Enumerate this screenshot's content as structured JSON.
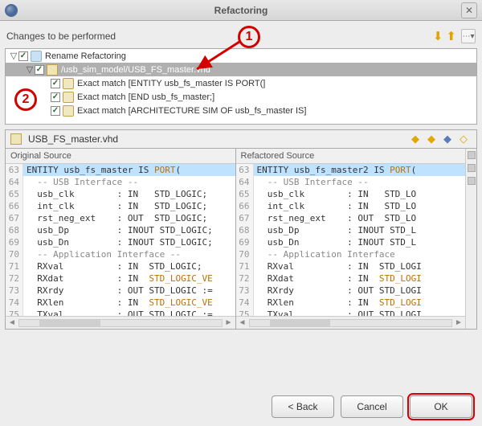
{
  "window": {
    "title": "Refactoring"
  },
  "changes": {
    "header": "Changes to be performed",
    "tree": [
      {
        "indent": 0,
        "expanded": true,
        "icon": "ref",
        "label": "Rename Refactoring"
      },
      {
        "indent": 1,
        "expanded": true,
        "icon": "file",
        "selected": true,
        "label": "/usb_sim_model/USB_FS_master.vhd"
      },
      {
        "indent": 2,
        "icon": "match",
        "label": "Exact match [ENTITY usb_fs_master IS PORT(]"
      },
      {
        "indent": 2,
        "icon": "match",
        "label": "Exact match [END usb_fs_master;]"
      },
      {
        "indent": 2,
        "icon": "match",
        "label": "Exact match [ARCHITECTURE SIM OF usb_fs_master IS]"
      }
    ]
  },
  "file": {
    "name": "USB_FS_master.vhd"
  },
  "diff": {
    "original_title": "Original Source",
    "refactored_title": "Refactored Source",
    "original": [
      {
        "n": 63,
        "hl": true,
        "segs": [
          [
            "ENTITY usb_fs_master IS ",
            ""
          ],
          [
            "PORT",
            "port"
          ],
          [
            "(",
            ""
          ]
        ]
      },
      {
        "n": 64,
        "segs": [
          [
            "  -- USB Interface --",
            "comment"
          ]
        ]
      },
      {
        "n": 65,
        "segs": [
          [
            "  usb_clk        : IN   STD_LOGIC;",
            ""
          ]
        ]
      },
      {
        "n": 66,
        "segs": [
          [
            "  int_clk        : IN   STD_LOGIC;",
            ""
          ]
        ]
      },
      {
        "n": 67,
        "segs": [
          [
            "  rst_neg_ext    : OUT  STD_LOGIC;",
            ""
          ]
        ]
      },
      {
        "n": 68,
        "segs": [
          [
            "  usb_Dp         : INOUT STD_LOGIC;",
            ""
          ]
        ]
      },
      {
        "n": 69,
        "segs": [
          [
            "  usb_Dn         : INOUT STD_LOGIC;",
            ""
          ]
        ]
      },
      {
        "n": 70,
        "segs": [
          [
            "  -- Application Interface --",
            "comment"
          ]
        ]
      },
      {
        "n": 71,
        "segs": [
          [
            "  RXval          : IN  STD_LOGIC;",
            ""
          ]
        ]
      },
      {
        "n": 72,
        "segs": [
          [
            "  RXdat          : IN  ",
            ""
          ],
          [
            "STD_LOGIC_VE",
            "type"
          ]
        ]
      },
      {
        "n": 73,
        "segs": [
          [
            "  RXrdy          : OUT STD_LOGIC :=",
            ""
          ]
        ]
      },
      {
        "n": 74,
        "segs": [
          [
            "  RXlen          : IN  ",
            ""
          ],
          [
            "STD_LOGIC_VE",
            "type"
          ]
        ]
      },
      {
        "n": 75,
        "segs": [
          [
            "  TXval          : OUT STD_LOGIC :=",
            ""
          ]
        ]
      }
    ],
    "refactored": [
      {
        "n": 63,
        "hl": true,
        "segs": [
          [
            "ENTITY usb_fs_master2 IS ",
            ""
          ],
          [
            "PORT",
            "port"
          ],
          [
            "(",
            ""
          ]
        ]
      },
      {
        "n": 64,
        "segs": [
          [
            "  -- USB Interface --",
            "comment"
          ]
        ]
      },
      {
        "n": 65,
        "segs": [
          [
            "  usb_clk        : IN   STD_LO",
            ""
          ]
        ]
      },
      {
        "n": 66,
        "segs": [
          [
            "  int_clk        : IN   STD_LO",
            ""
          ]
        ]
      },
      {
        "n": 67,
        "segs": [
          [
            "  rst_neg_ext    : OUT  STD_LO",
            ""
          ]
        ]
      },
      {
        "n": 68,
        "segs": [
          [
            "  usb_Dp         : INOUT STD_L",
            ""
          ]
        ]
      },
      {
        "n": 69,
        "segs": [
          [
            "  usb_Dn         : INOUT STD_L",
            ""
          ]
        ]
      },
      {
        "n": 70,
        "segs": [
          [
            "  -- Application Interface",
            "comment"
          ]
        ]
      },
      {
        "n": 71,
        "segs": [
          [
            "  RXval          : IN  STD_LOGI",
            ""
          ]
        ]
      },
      {
        "n": 72,
        "segs": [
          [
            "  RXdat          : IN  ",
            ""
          ],
          [
            "STD_LOGI",
            "type"
          ]
        ]
      },
      {
        "n": 73,
        "segs": [
          [
            "  RXrdy          : OUT STD_LOGI",
            ""
          ]
        ]
      },
      {
        "n": 74,
        "segs": [
          [
            "  RXlen          : IN  ",
            ""
          ],
          [
            "STD_LOGI",
            "type"
          ]
        ]
      },
      {
        "n": 75,
        "segs": [
          [
            "  TXval          : OUT STD_LOGI",
            ""
          ]
        ]
      }
    ]
  },
  "buttons": {
    "back": "< Back",
    "cancel": "Cancel",
    "ok": "OK"
  },
  "annotations": {
    "1": "1",
    "2": "2"
  }
}
